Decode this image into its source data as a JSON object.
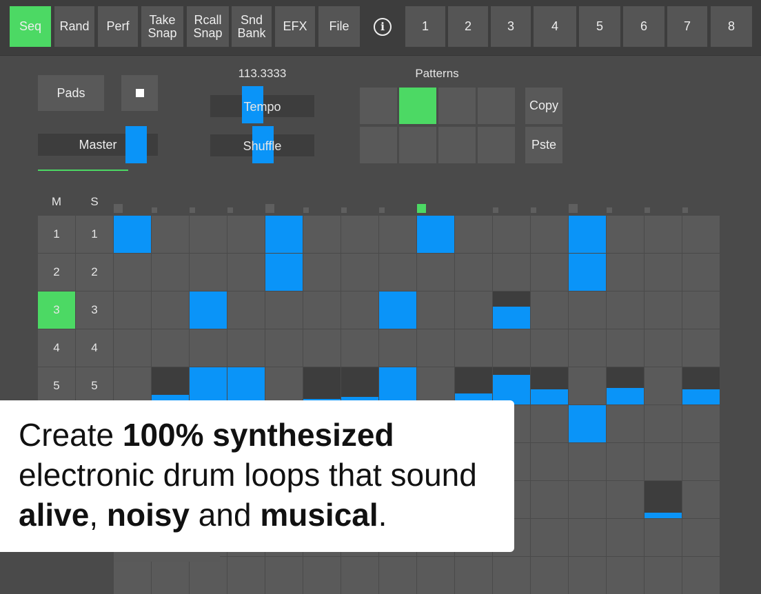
{
  "toolbar": {
    "items": [
      {
        "label": "Seq",
        "active": true
      },
      {
        "label": "Rand"
      },
      {
        "label": "Perf"
      },
      {
        "label": "Take\nSnap"
      },
      {
        "label": "Rcall\nSnap"
      },
      {
        "label": "Snd\nBank"
      },
      {
        "label": "EFX"
      },
      {
        "label": "File"
      }
    ],
    "info_icon": "info-icon",
    "tracks": [
      "1",
      "2",
      "3",
      "4",
      "5",
      "6",
      "7",
      "8"
    ]
  },
  "controls": {
    "pads_label": "Pads",
    "stop_icon": "stop-icon",
    "master_label": "Master",
    "tempo_value": "113.3333",
    "tempo_label": "Tempo",
    "shuffle_label": "Shuffle",
    "patterns_label": "Patterns",
    "patterns_active_index": 1,
    "copy_label": "Copy",
    "paste_label": "Pste"
  },
  "sequencer": {
    "mute_header": "M",
    "solo_header": "S",
    "rows": [
      "1",
      "2",
      "3",
      "4",
      "5"
    ],
    "selected_row": "3",
    "current_step": 9,
    "steps": 16
  },
  "promo": {
    "line1_prefix": "Create ",
    "line1_bold": "100% synthesized",
    "line2": "electronic drum loops that sound",
    "line3_bold1": "alive",
    "line3_sep1": ", ",
    "line3_bold2": "noisy",
    "line3_sep2": " and ",
    "line3_bold3": "musical",
    "line3_end": "."
  },
  "colors": {
    "accent_green": "#4cd964",
    "step_blue": "#0a94f8",
    "background": "#4a4a4a"
  }
}
